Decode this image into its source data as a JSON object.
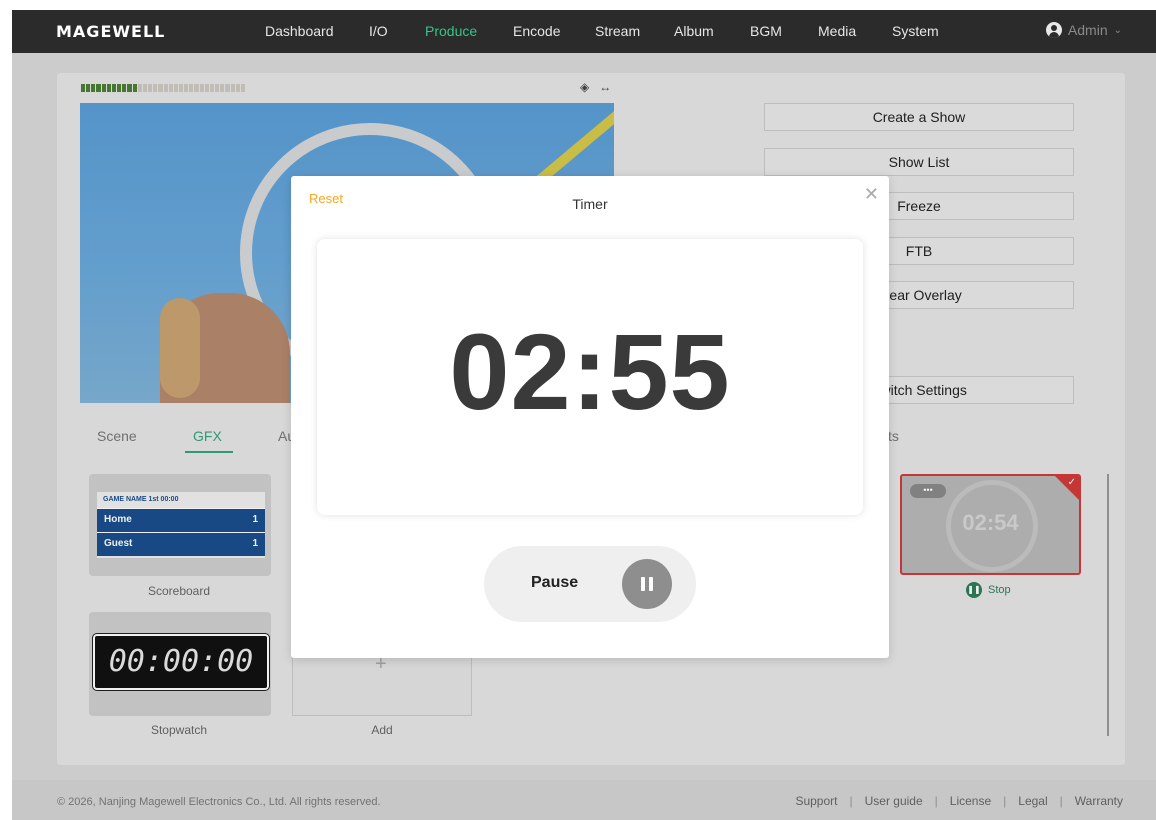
{
  "brand": {
    "logo": "MAGEWELL"
  },
  "nav": {
    "items": [
      {
        "label": "Dashboard"
      },
      {
        "label": "I/O"
      },
      {
        "label": "Produce"
      },
      {
        "label": "Encode"
      },
      {
        "label": "Stream"
      },
      {
        "label": "Album"
      },
      {
        "label": "BGM"
      },
      {
        "label": "Media"
      },
      {
        "label": "System"
      }
    ],
    "active": "Produce",
    "user": "Admin"
  },
  "actions": {
    "create_show": "Create a Show",
    "show_list": "Show List",
    "freeze": "Freeze",
    "ftb": "FTB",
    "clear_overlay": "Clear Overlay",
    "switch_settings": "Switch Settings"
  },
  "tabs": {
    "scene": "Scene",
    "gfx": "GFX",
    "partial": "Au",
    "right_partial": "ts"
  },
  "gfx": {
    "scoreboard": {
      "label": "Scoreboard",
      "header": "GAME NAME  1st  00:00",
      "home": "Home",
      "home_score": "1",
      "guest": "Guest",
      "guest_score": "1"
    },
    "stopwatch": {
      "label": "Stopwatch",
      "display": "00:00:00"
    },
    "add": {
      "label": "Add"
    },
    "timer_thumb": {
      "time": "02:54",
      "dots": "•••",
      "status": "Stop"
    }
  },
  "modal": {
    "title": "Timer",
    "reset": "Reset",
    "value": "02:55",
    "pause_label": "Pause"
  },
  "footer": {
    "copyright": "© 2026, Nanjing Magewell Electronics Co., Ltd. All rights reserved.",
    "links": [
      "Support",
      "User guide",
      "License",
      "Legal",
      "Warranty"
    ]
  },
  "colors": {
    "accent": "#34c58b",
    "reset": "#f5a623",
    "nav_bg": "#2b2b2b",
    "selected_border": "#d23a3a"
  }
}
